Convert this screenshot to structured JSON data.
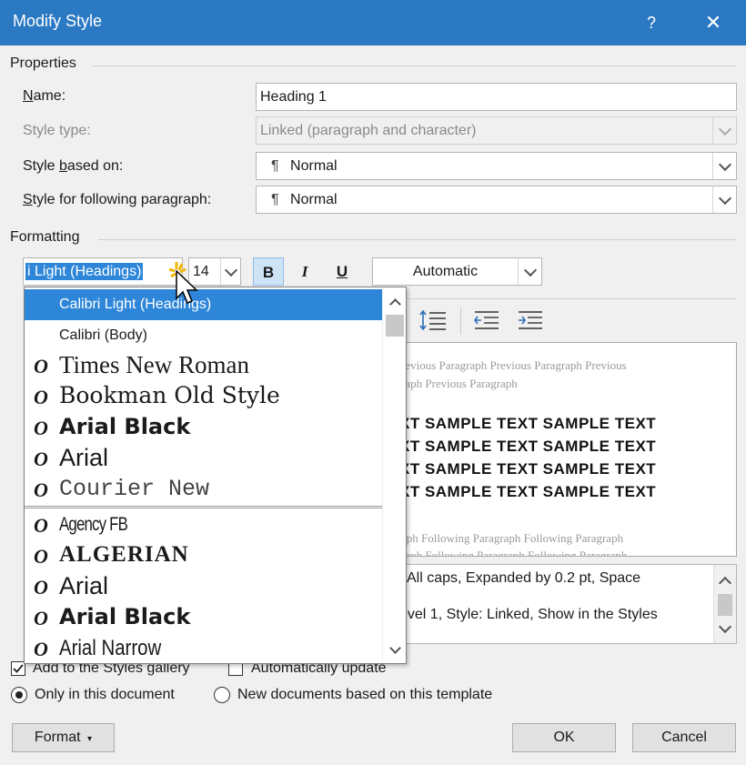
{
  "title": "Modify Style",
  "help_glyph": "?",
  "close_glyph": "✕",
  "properties": {
    "section_label": "Properties",
    "name_label": "Name:",
    "name_value": "Heading 1",
    "style_type_label": "Style type:",
    "style_type_value": "Linked (paragraph and character)",
    "based_on_label": "Style based on:",
    "based_on_value": "Normal",
    "following_label": "Style for following paragraph:",
    "following_value": "Normal",
    "pilcrow": "¶"
  },
  "formatting": {
    "section_label": "Formatting",
    "font_value": "i Light (Headings)",
    "size_value": "14",
    "bold_label": "B",
    "italic_label": "I",
    "underline_label": "U",
    "color_value": "Automatic"
  },
  "font_list": {
    "top_items": [
      {
        "name": "Calibri Light (Headings)",
        "selected": true
      },
      {
        "name": "Calibri (Body)",
        "selected": false
      }
    ],
    "recent_fonts": [
      "Times New Roman",
      "Bookman Old Style",
      "Arial Black",
      "Arial",
      "Courier New"
    ],
    "all_fonts": [
      "Agency FB",
      "ALGERIAN",
      "Arial",
      "Arial Black",
      "Arial Narrow"
    ],
    "font_type_glyph": "O"
  },
  "preview": {
    "prev_line1": "revious  Paragraph  Previous  Paragraph  Previous",
    "prev_line2": "raph Previous Paragraph",
    "sample_line": "XT  SAMPLE  TEXT  SAMPLE  TEXT",
    "follow_line1": "aph  Following  Paragraph  Following  Paragraph",
    "follow_line2": "raph  Following  Paragraph  Following  Paragraph"
  },
  "description": {
    "line1": ", All caps, Expanded by  0.2 pt, Space",
    "line2": "evel 1, Style: Linked, Show in the Styles"
  },
  "options": {
    "add_to_gallery": "Add to the Styles gallery",
    "auto_update": "Automatically update",
    "only_this_doc": "Only in this document",
    "new_docs": "New documents based on this template"
  },
  "buttons": {
    "format": "Format",
    "ok": "OK",
    "cancel": "Cancel"
  },
  "colors": {
    "titlebar": "#2b79c2",
    "selection": "#2e86d9",
    "active_toggle": "#cde4f7"
  }
}
